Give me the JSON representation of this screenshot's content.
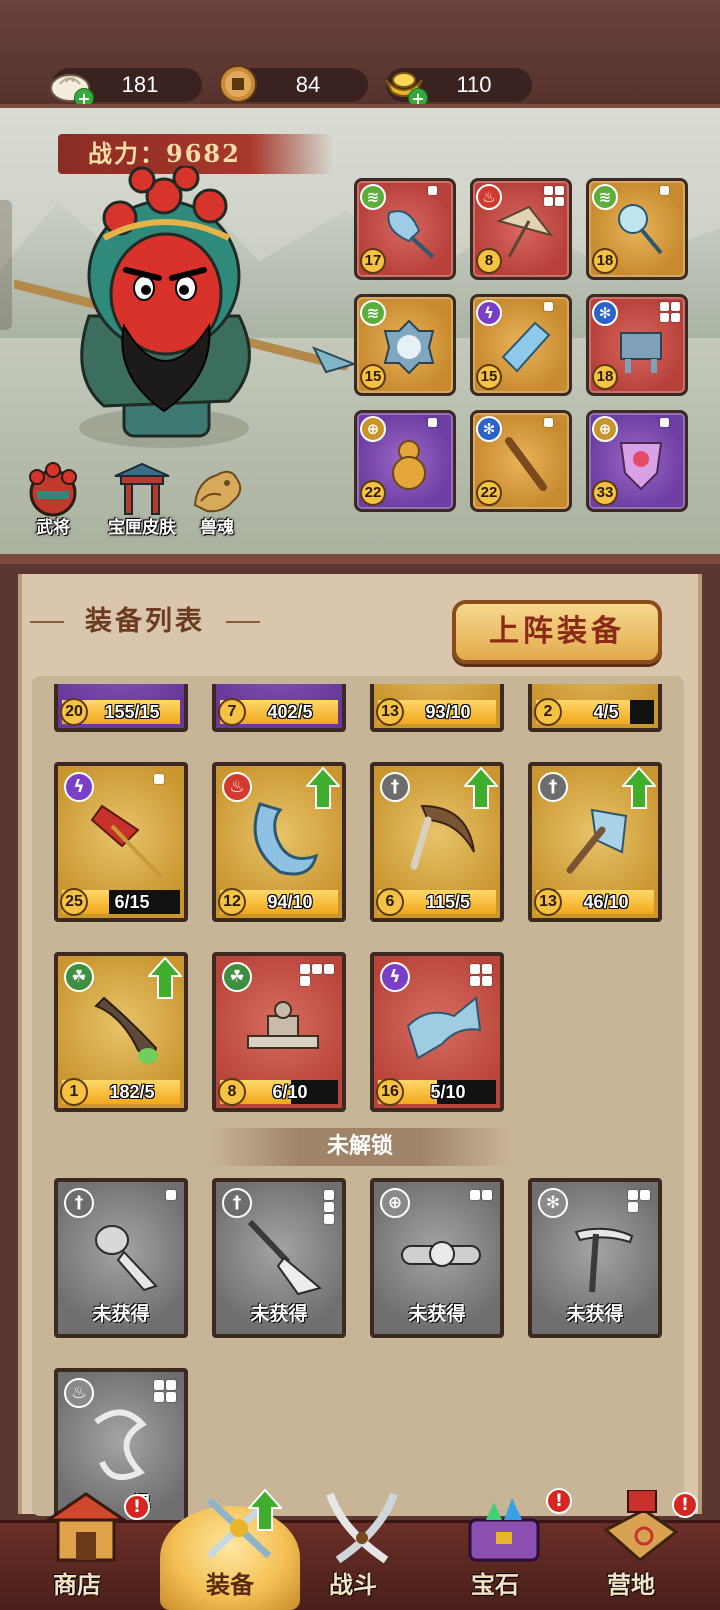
{
  "resources": {
    "steamed_bun": "181",
    "coin": "84",
    "gold_ingot": "110"
  },
  "hero": {
    "power_label": "战力：9682"
  },
  "side_buttons": {
    "general": "武将",
    "skin": "宝匣皮肤",
    "beast_soul": "兽魂"
  },
  "equipped": [
    {
      "level": "17",
      "element": "wind",
      "rarity": "red",
      "item": "jade-fan"
    },
    {
      "level": "8",
      "element": "fire",
      "rarity": "red",
      "item": "umbrella"
    },
    {
      "level": "18",
      "element": "wind",
      "rarity": "gold",
      "item": "scepter"
    },
    {
      "level": "15",
      "element": "wind",
      "rarity": "gold",
      "item": "mirror"
    },
    {
      "level": "15",
      "element": "thunder",
      "rarity": "gold",
      "item": "talisman"
    },
    {
      "level": "18",
      "element": "ice",
      "rarity": "red",
      "item": "bronze-cauldron"
    },
    {
      "level": "22",
      "element": "target",
      "rarity": "purple",
      "item": "gourd"
    },
    {
      "level": "22",
      "element": "ice",
      "rarity": "gold",
      "item": "flute"
    },
    {
      "level": "33",
      "element": "target",
      "rarity": "purple",
      "item": "amulet"
    }
  ],
  "panel": {
    "title": "装备列表",
    "deploy_button": "上阵装备",
    "locked_label": "未解锁"
  },
  "inventory_partial": [
    {
      "level": "20",
      "count": "155/15",
      "progress": 1.0
    },
    {
      "level": "7",
      "count": "402/5",
      "progress": 1.0
    },
    {
      "level": "13",
      "count": "93/10",
      "progress": 1.0
    },
    {
      "level": "2",
      "count": "4/5",
      "progress": 0.8
    }
  ],
  "inventory": [
    {
      "level": "25",
      "count": "6/15",
      "progress": 0.4,
      "element": "thunder",
      "rarity": "gold",
      "upgrade": false,
      "item": "banner-icon"
    },
    {
      "level": "12",
      "count": "94/10",
      "progress": 1.0,
      "element": "fire",
      "rarity": "gold",
      "upgrade": true,
      "item": "crescent-icon"
    },
    {
      "level": "6",
      "count": "115/5",
      "progress": 1.0,
      "element": "sword",
      "rarity": "gold",
      "upgrade": true,
      "item": "sickle-icon"
    },
    {
      "level": "13",
      "count": "46/10",
      "progress": 1.0,
      "element": "sword",
      "rarity": "gold",
      "upgrade": true,
      "item": "axe-icon"
    },
    {
      "level": "1",
      "count": "182/5",
      "progress": 1.0,
      "element": "poison",
      "rarity": "gold",
      "upgrade": true,
      "item": "club-icon"
    },
    {
      "level": "8",
      "count": "6/10",
      "progress": 0.6,
      "element": "poison",
      "rarity": "red",
      "upgrade": false,
      "item": "inkstone-icon"
    },
    {
      "level": "16",
      "count": "5/10",
      "progress": 0.5,
      "element": "thunder",
      "rarity": "red",
      "upgrade": false,
      "item": "scroll-icon"
    }
  ],
  "unobtained": [
    {
      "label": "未获得",
      "element": "sword",
      "item": "mace-icon"
    },
    {
      "label": "未获得",
      "element": "sword",
      "item": "glaive-icon"
    },
    {
      "label": "未获得",
      "element": "target",
      "item": "belt-icon"
    },
    {
      "label": "未获得",
      "element": "ice",
      "item": "pickaxe-icon"
    },
    {
      "label": "得",
      "element": "fire",
      "item": "bow-icon"
    }
  ],
  "nav": {
    "shop": "商店",
    "equipment": "装备",
    "battle": "战斗",
    "gems": "宝石",
    "camp": "营地"
  },
  "badges": {
    "mark": "!"
  },
  "colors": {
    "background": "#5b3732",
    "panel": "#d9c6ad",
    "progress": "#f1a81c",
    "upgrade_arrow": "#3fae2c",
    "badge": "#d6261f"
  }
}
